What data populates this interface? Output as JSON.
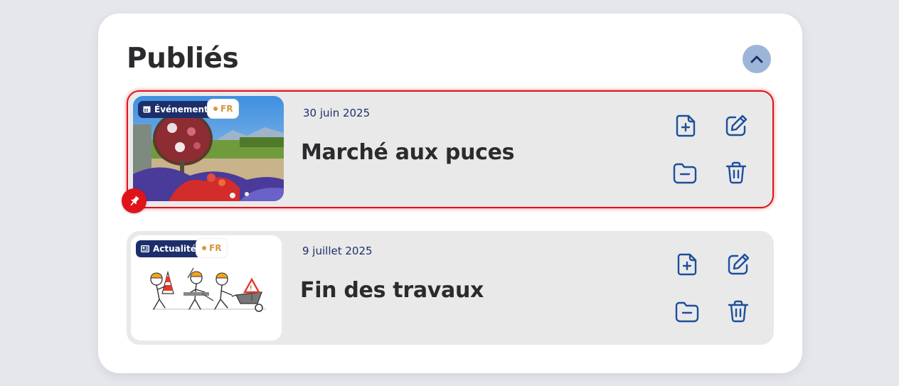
{
  "section": {
    "title": "Publiés",
    "collapse_icon": "chevron-up-icon"
  },
  "colors": {
    "navy": "#1c2f6b",
    "pin_red": "#e0131a",
    "lang_gold": "#d6963d",
    "card_bg": "#e9e9ea",
    "collapse_bg": "#9db6d8"
  },
  "items": [
    {
      "type_label": "Événement",
      "type_icon": "calendar-icon",
      "lang": "FR",
      "date": "30 juin 2025",
      "title": "Marché aux puces",
      "pinned": true,
      "thumbnail": "flower-garden-photo",
      "actions": [
        "add-document-icon",
        "edit-icon",
        "archive-folder-icon",
        "trash-icon"
      ]
    },
    {
      "type_label": "Actualité",
      "type_icon": "newspaper-icon",
      "lang": "FR",
      "date": "9 juillet 2025",
      "title": "Fin des travaux",
      "pinned": false,
      "thumbnail": "construction-workers-illustration",
      "actions": [
        "add-document-icon",
        "edit-icon",
        "archive-folder-icon",
        "trash-icon"
      ]
    }
  ]
}
